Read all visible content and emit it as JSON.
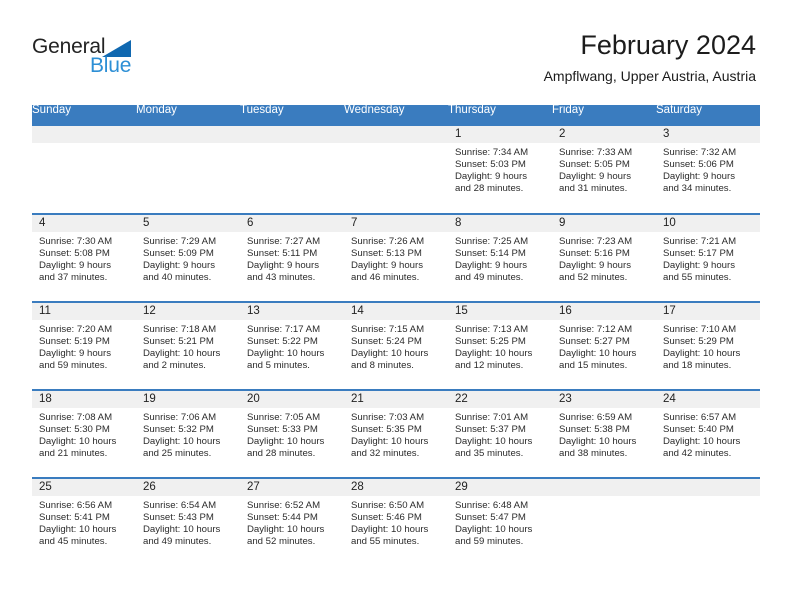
{
  "brand": {
    "name_part1": "General",
    "name_part2": "Blue"
  },
  "header": {
    "title": "February 2024",
    "subtitle": "Ampflwang, Upper Austria, Austria"
  },
  "colors": {
    "header_blue": "#3a7cbf",
    "brand_blue": "#2d8fd5",
    "triangle_blue": "#1068b0",
    "day_band_gray": "#f0f0f0"
  },
  "weekday_headers": [
    "Sunday",
    "Monday",
    "Tuesday",
    "Wednesday",
    "Thursday",
    "Friday",
    "Saturday"
  ],
  "weeks": [
    [
      {
        "day": "",
        "sunrise": "",
        "sunset": "",
        "daylight_line1": "",
        "daylight_line2": ""
      },
      {
        "day": "",
        "sunrise": "",
        "sunset": "",
        "daylight_line1": "",
        "daylight_line2": ""
      },
      {
        "day": "",
        "sunrise": "",
        "sunset": "",
        "daylight_line1": "",
        "daylight_line2": ""
      },
      {
        "day": "",
        "sunrise": "",
        "sunset": "",
        "daylight_line1": "",
        "daylight_line2": ""
      },
      {
        "day": "1",
        "sunrise": "Sunrise: 7:34 AM",
        "sunset": "Sunset: 5:03 PM",
        "daylight_line1": "Daylight: 9 hours",
        "daylight_line2": "and 28 minutes."
      },
      {
        "day": "2",
        "sunrise": "Sunrise: 7:33 AM",
        "sunset": "Sunset: 5:05 PM",
        "daylight_line1": "Daylight: 9 hours",
        "daylight_line2": "and 31 minutes."
      },
      {
        "day": "3",
        "sunrise": "Sunrise: 7:32 AM",
        "sunset": "Sunset: 5:06 PM",
        "daylight_line1": "Daylight: 9 hours",
        "daylight_line2": "and 34 minutes."
      }
    ],
    [
      {
        "day": "4",
        "sunrise": "Sunrise: 7:30 AM",
        "sunset": "Sunset: 5:08 PM",
        "daylight_line1": "Daylight: 9 hours",
        "daylight_line2": "and 37 minutes."
      },
      {
        "day": "5",
        "sunrise": "Sunrise: 7:29 AM",
        "sunset": "Sunset: 5:09 PM",
        "daylight_line1": "Daylight: 9 hours",
        "daylight_line2": "and 40 minutes."
      },
      {
        "day": "6",
        "sunrise": "Sunrise: 7:27 AM",
        "sunset": "Sunset: 5:11 PM",
        "daylight_line1": "Daylight: 9 hours",
        "daylight_line2": "and 43 minutes."
      },
      {
        "day": "7",
        "sunrise": "Sunrise: 7:26 AM",
        "sunset": "Sunset: 5:13 PM",
        "daylight_line1": "Daylight: 9 hours",
        "daylight_line2": "and 46 minutes."
      },
      {
        "day": "8",
        "sunrise": "Sunrise: 7:25 AM",
        "sunset": "Sunset: 5:14 PM",
        "daylight_line1": "Daylight: 9 hours",
        "daylight_line2": "and 49 minutes."
      },
      {
        "day": "9",
        "sunrise": "Sunrise: 7:23 AM",
        "sunset": "Sunset: 5:16 PM",
        "daylight_line1": "Daylight: 9 hours",
        "daylight_line2": "and 52 minutes."
      },
      {
        "day": "10",
        "sunrise": "Sunrise: 7:21 AM",
        "sunset": "Sunset: 5:17 PM",
        "daylight_line1": "Daylight: 9 hours",
        "daylight_line2": "and 55 minutes."
      }
    ],
    [
      {
        "day": "11",
        "sunrise": "Sunrise: 7:20 AM",
        "sunset": "Sunset: 5:19 PM",
        "daylight_line1": "Daylight: 9 hours",
        "daylight_line2": "and 59 minutes."
      },
      {
        "day": "12",
        "sunrise": "Sunrise: 7:18 AM",
        "sunset": "Sunset: 5:21 PM",
        "daylight_line1": "Daylight: 10 hours",
        "daylight_line2": "and 2 minutes."
      },
      {
        "day": "13",
        "sunrise": "Sunrise: 7:17 AM",
        "sunset": "Sunset: 5:22 PM",
        "daylight_line1": "Daylight: 10 hours",
        "daylight_line2": "and 5 minutes."
      },
      {
        "day": "14",
        "sunrise": "Sunrise: 7:15 AM",
        "sunset": "Sunset: 5:24 PM",
        "daylight_line1": "Daylight: 10 hours",
        "daylight_line2": "and 8 minutes."
      },
      {
        "day": "15",
        "sunrise": "Sunrise: 7:13 AM",
        "sunset": "Sunset: 5:25 PM",
        "daylight_line1": "Daylight: 10 hours",
        "daylight_line2": "and 12 minutes."
      },
      {
        "day": "16",
        "sunrise": "Sunrise: 7:12 AM",
        "sunset": "Sunset: 5:27 PM",
        "daylight_line1": "Daylight: 10 hours",
        "daylight_line2": "and 15 minutes."
      },
      {
        "day": "17",
        "sunrise": "Sunrise: 7:10 AM",
        "sunset": "Sunset: 5:29 PM",
        "daylight_line1": "Daylight: 10 hours",
        "daylight_line2": "and 18 minutes."
      }
    ],
    [
      {
        "day": "18",
        "sunrise": "Sunrise: 7:08 AM",
        "sunset": "Sunset: 5:30 PM",
        "daylight_line1": "Daylight: 10 hours",
        "daylight_line2": "and 21 minutes."
      },
      {
        "day": "19",
        "sunrise": "Sunrise: 7:06 AM",
        "sunset": "Sunset: 5:32 PM",
        "daylight_line1": "Daylight: 10 hours",
        "daylight_line2": "and 25 minutes."
      },
      {
        "day": "20",
        "sunrise": "Sunrise: 7:05 AM",
        "sunset": "Sunset: 5:33 PM",
        "daylight_line1": "Daylight: 10 hours",
        "daylight_line2": "and 28 minutes."
      },
      {
        "day": "21",
        "sunrise": "Sunrise: 7:03 AM",
        "sunset": "Sunset: 5:35 PM",
        "daylight_line1": "Daylight: 10 hours",
        "daylight_line2": "and 32 minutes."
      },
      {
        "day": "22",
        "sunrise": "Sunrise: 7:01 AM",
        "sunset": "Sunset: 5:37 PM",
        "daylight_line1": "Daylight: 10 hours",
        "daylight_line2": "and 35 minutes."
      },
      {
        "day": "23",
        "sunrise": "Sunrise: 6:59 AM",
        "sunset": "Sunset: 5:38 PM",
        "daylight_line1": "Daylight: 10 hours",
        "daylight_line2": "and 38 minutes."
      },
      {
        "day": "24",
        "sunrise": "Sunrise: 6:57 AM",
        "sunset": "Sunset: 5:40 PM",
        "daylight_line1": "Daylight: 10 hours",
        "daylight_line2": "and 42 minutes."
      }
    ],
    [
      {
        "day": "25",
        "sunrise": "Sunrise: 6:56 AM",
        "sunset": "Sunset: 5:41 PM",
        "daylight_line1": "Daylight: 10 hours",
        "daylight_line2": "and 45 minutes."
      },
      {
        "day": "26",
        "sunrise": "Sunrise: 6:54 AM",
        "sunset": "Sunset: 5:43 PM",
        "daylight_line1": "Daylight: 10 hours",
        "daylight_line2": "and 49 minutes."
      },
      {
        "day": "27",
        "sunrise": "Sunrise: 6:52 AM",
        "sunset": "Sunset: 5:44 PM",
        "daylight_line1": "Daylight: 10 hours",
        "daylight_line2": "and 52 minutes."
      },
      {
        "day": "28",
        "sunrise": "Sunrise: 6:50 AM",
        "sunset": "Sunset: 5:46 PM",
        "daylight_line1": "Daylight: 10 hours",
        "daylight_line2": "and 55 minutes."
      },
      {
        "day": "29",
        "sunrise": "Sunrise: 6:48 AM",
        "sunset": "Sunset: 5:47 PM",
        "daylight_line1": "Daylight: 10 hours",
        "daylight_line2": "and 59 minutes."
      },
      {
        "day": "",
        "sunrise": "",
        "sunset": "",
        "daylight_line1": "",
        "daylight_line2": ""
      },
      {
        "day": "",
        "sunrise": "",
        "sunset": "",
        "daylight_line1": "",
        "daylight_line2": ""
      }
    ]
  ]
}
